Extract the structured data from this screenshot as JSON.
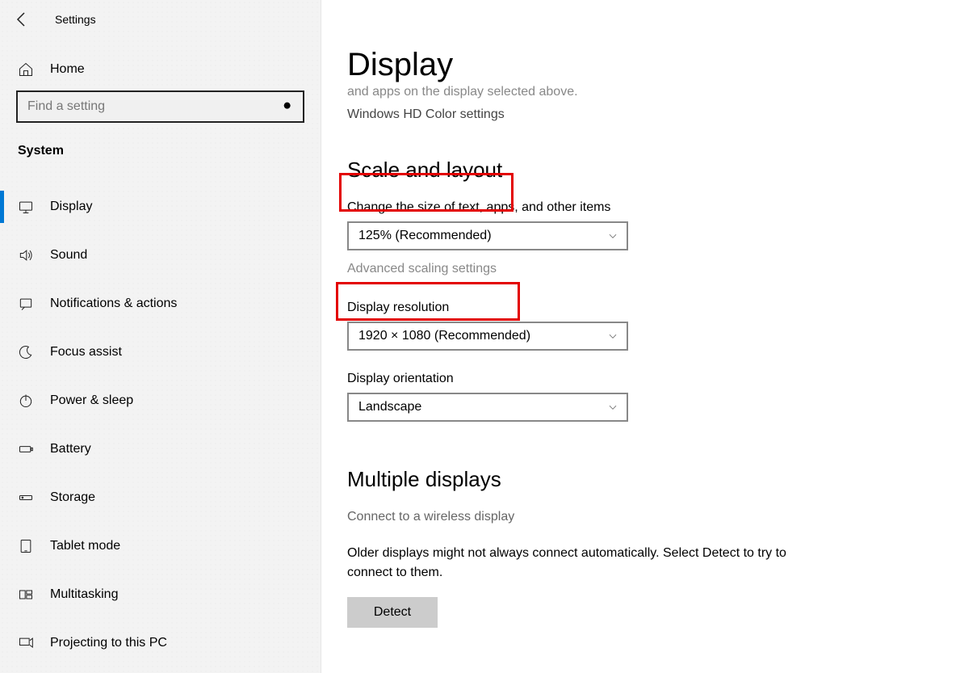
{
  "topbar": {
    "title": "Settings"
  },
  "home": {
    "label": "Home"
  },
  "search": {
    "placeholder": "Find a setting"
  },
  "category": {
    "title": "System"
  },
  "sidebar": {
    "items": [
      {
        "label": "Display",
        "icon": "monitor-icon",
        "active": true
      },
      {
        "label": "Sound",
        "icon": "sound-icon"
      },
      {
        "label": "Notifications & actions",
        "icon": "notifications-icon"
      },
      {
        "label": "Focus assist",
        "icon": "moon-icon"
      },
      {
        "label": "Power & sleep",
        "icon": "power-icon"
      },
      {
        "label": "Battery",
        "icon": "battery-icon"
      },
      {
        "label": "Storage",
        "icon": "storage-icon"
      },
      {
        "label": "Tablet mode",
        "icon": "tablet-icon"
      },
      {
        "label": "Multitasking",
        "icon": "multitasking-icon"
      },
      {
        "label": "Projecting to this PC",
        "icon": "projecting-icon"
      }
    ]
  },
  "page": {
    "title": "Display",
    "snippet": "and apps on the display selected above.",
    "hd_link": "Windows HD Color settings",
    "scale_heading": "Scale and layout",
    "scale_label": "Change the size of text, apps, and other items",
    "scale_value": "125% (Recommended)",
    "advanced_link": "Advanced scaling settings",
    "resolution_label": "Display resolution",
    "resolution_value": "1920 × 1080 (Recommended)",
    "orientation_label": "Display orientation",
    "orientation_value": "Landscape",
    "multiple_heading": "Multiple displays",
    "wireless_link": "Connect to a wireless display",
    "detect_text": "Older displays might not always connect automatically. Select Detect to try to connect to them.",
    "detect_button": "Detect"
  }
}
